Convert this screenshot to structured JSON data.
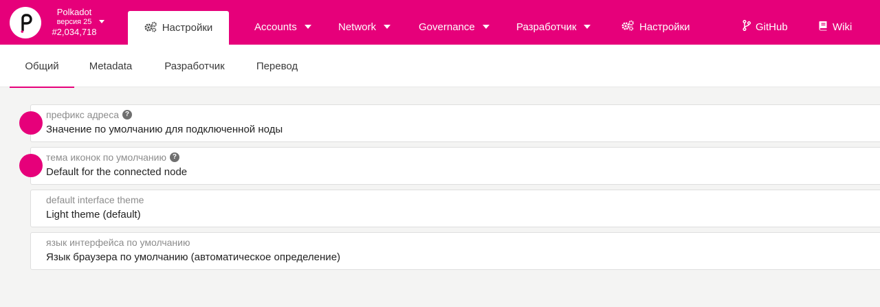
{
  "header": {
    "chain": {
      "name": "Polkadot",
      "version": "версия 25",
      "block": "#2,034,718"
    },
    "active_tab": {
      "label": "Настройки",
      "icon": "gears-icon"
    },
    "nav": [
      {
        "label": "Accounts",
        "has_dropdown": true
      },
      {
        "label": "Network",
        "has_dropdown": true
      },
      {
        "label": "Governance",
        "has_dropdown": true
      },
      {
        "label": "Разработчик",
        "has_dropdown": true
      },
      {
        "label": "Настройки",
        "icon": "gears-icon"
      },
      {
        "label": "GitHub",
        "icon": "git-branch-icon"
      },
      {
        "label": "Wiki",
        "icon": "book-icon"
      }
    ]
  },
  "subtabs": [
    {
      "label": "Общий",
      "active": true
    },
    {
      "label": "Metadata"
    },
    {
      "label": "Разработчик"
    },
    {
      "label": "Перевод"
    }
  ],
  "settings": [
    {
      "label": "префикс адреса",
      "value": "Значение по умолчанию для подключенной ноды",
      "help": true
    },
    {
      "label": "тема иконок по умолчанию",
      "value": "Default for the connected node",
      "help": true
    },
    {
      "label": "default interface theme",
      "value": "Light theme (default)"
    },
    {
      "label": "язык интерфейса по умолчанию",
      "value": "Язык браузера по умолчанию (автоматическое определение)"
    }
  ],
  "colors": {
    "brand": "#e6007a",
    "background": "#f4f4f3",
    "text": "#3a3a3a",
    "muted": "#8c8c8c"
  }
}
